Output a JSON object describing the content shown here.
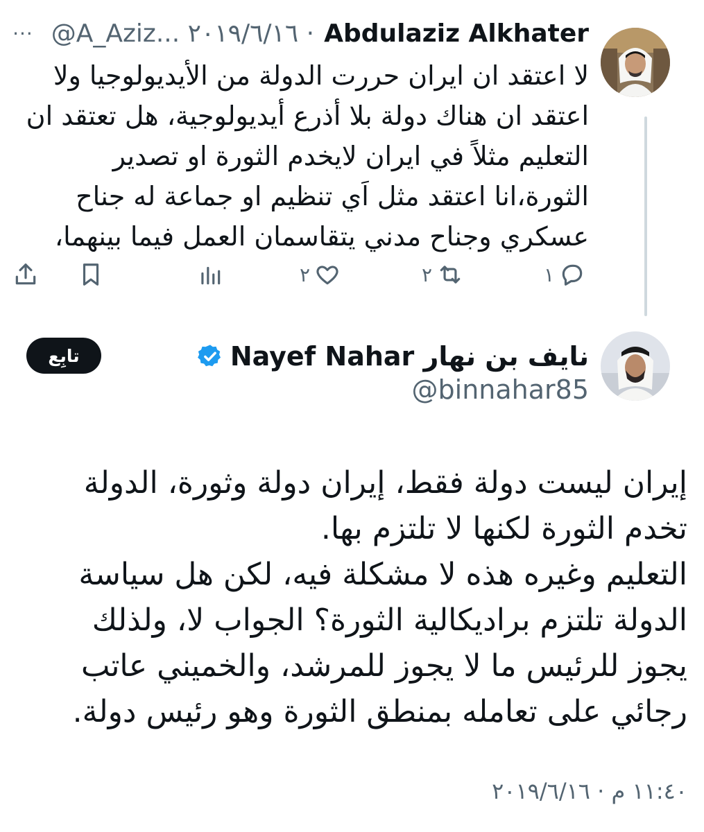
{
  "parent_tweet": {
    "author_name": "Abdulaziz Alkhater",
    "handle_date": "@A_Aziz... ٢٠١٩/٦/١٦ ·",
    "more_label": "···",
    "text": "لا اعتقد ان ايران حررت الدولة من الأيديولوجيا ولا اعتقد ان هناك دولة بلا أذرع أيديولوجية، هل تعتقد ان التعليم مثلاً في ايران لايخدم الثورة او تصدير الثورة،انا اعتقد مثل اَي تنظيم او جماعة له جناح عسكري وجناح مدني يتقاسمان العمل فيما بينهما،",
    "actions": {
      "reply_count": "١",
      "retweet_count": "٢",
      "like_count": "٢"
    },
    "icons": [
      "reply-icon",
      "retweet-icon",
      "like-icon",
      "views-icon",
      "bookmark-icon",
      "share-icon"
    ]
  },
  "main_tweet": {
    "author_name": "نايف بن نهار Nayef Nahar",
    "handle": "@binnahar85",
    "follow_label": "تابِع",
    "paragraphs": [
      "إيران ليست دولة فقط، إيران دولة وثورة، الدولة تخدم الثورة لكنها لا تلتزم بها.",
      "التعليم وغيره هذه لا مشكلة فيه، لكن هل سياسة الدولة تلتزم براديكالية الثورة؟ الجواب لا، ولذلك يجوز للرئيس ما لا يجوز للمرشد، والخميني عاتب رجائي على تعامله بمنطق الثورة وهو رئيس دولة."
    ],
    "timestamp": "١١:٤٠ م · ٢٠١٩/٦/١٦"
  },
  "colors": {
    "text_primary": "#0f1419",
    "text_secondary": "#536471",
    "verified_blue": "#1d9bf0",
    "thread_line": "#cfd9de"
  }
}
